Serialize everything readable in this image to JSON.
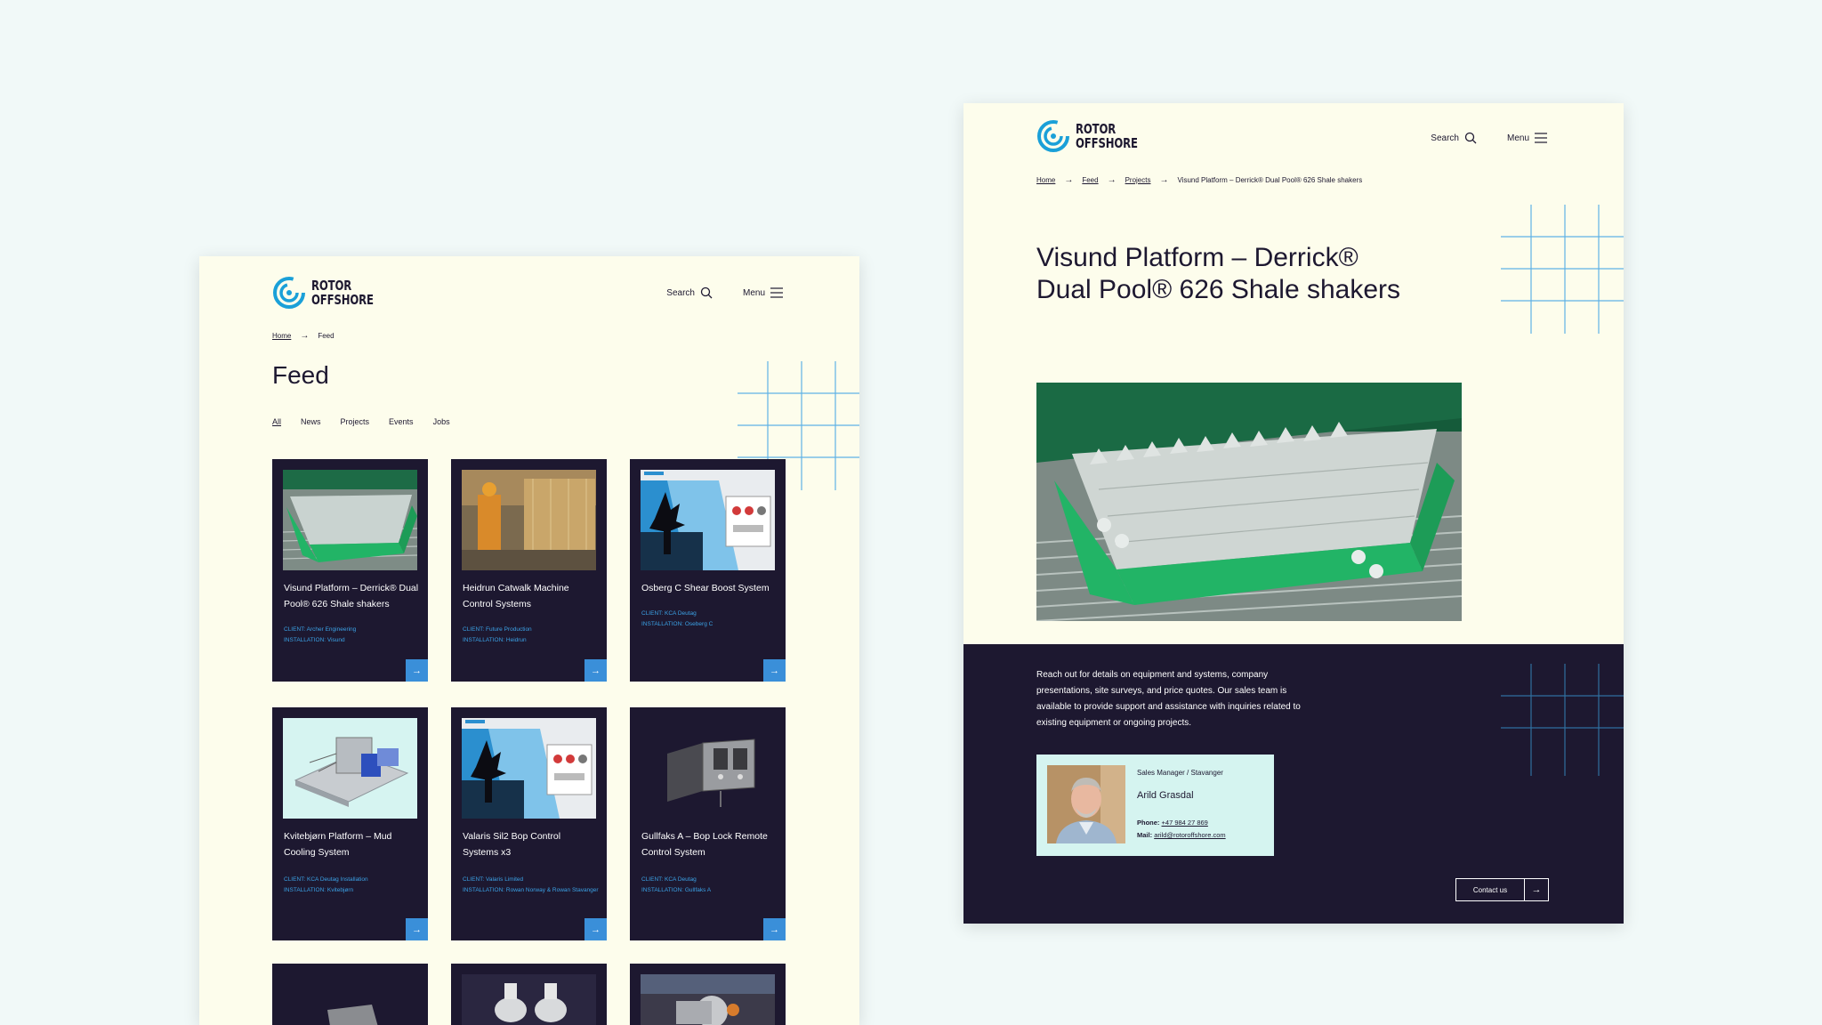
{
  "colors": {
    "navy": "#1d1830",
    "cream": "#fdfdec",
    "accent_blue": "#3a8fd9",
    "logo_cyan": "#1aa0d8",
    "pale_teal": "#d5f4f0"
  },
  "brand": {
    "line1": "ROTOR",
    "line2": "OFFSHORE",
    "icon": "rotor-swirl-icon"
  },
  "header": {
    "search_label": "Search",
    "menu_label": "Menu",
    "search_icon": "search-icon",
    "menu_icon": "hamburger-icon"
  },
  "feed_page": {
    "breadcrumb": [
      "Home",
      "Feed"
    ],
    "title": "Feed",
    "filters": [
      "All",
      "News",
      "Projects",
      "Events",
      "Jobs"
    ],
    "active_filter": "All",
    "cards": [
      {
        "title": "Visund Platform – Derrick® Dual Pool® 626 Shale shakers",
        "client": "CLIENT: Archer Engineering",
        "installation": "INSTALLATION: Visund"
      },
      {
        "title": "Heidrun Catwalk Machine Control Systems",
        "client": "CLIENT: Future Production",
        "installation": "INSTALLATION: Heidrun"
      },
      {
        "title": "Osberg C Shear Boost System",
        "client": "CLIENT: KCA Deutag",
        "installation": "INSTALLATION: Oseberg C"
      },
      {
        "title": "Kvitebjørn Platform – Mud Cooling System",
        "client": "CLIENT: KCA Deutag Installation",
        "installation": "INSTALLATION: Kvitebjørn"
      },
      {
        "title": "Valaris Sil2 Bop Control Systems x3",
        "client": "CLIENT: Valaris Limited",
        "installation": "INSTALLATION: Rowan Norway & Rowan Stavanger"
      },
      {
        "title": "Gullfaks A – Bop Lock Remote Control System",
        "client": "CLIENT: KCA Deutag",
        "installation": "INSTALLATION: Gullfaks A"
      }
    ]
  },
  "detail_page": {
    "breadcrumb": [
      "Home",
      "Feed",
      "Projects",
      "Visund Platform – Derrick® Dual Pool® 626 Shale shakers"
    ],
    "title": "Visund Platform – Derrick® Dual Pool® 626 Shale shakers",
    "contact_text": "Reach out for details on equipment and systems, company presentations, site surveys, and price quotes. Our sales team is available to provide support and assistance with inquiries related to existing equipment or ongoing projects.",
    "person": {
      "role": "Sales Manager / Stavanger",
      "name": "Arild Grasdal",
      "phone_label": "Phone:",
      "phone": "+47 984 27 869",
      "mail_label": "Mail:",
      "mail": "arild@rotoroffshore.com"
    },
    "contact_button": "Contact us"
  }
}
